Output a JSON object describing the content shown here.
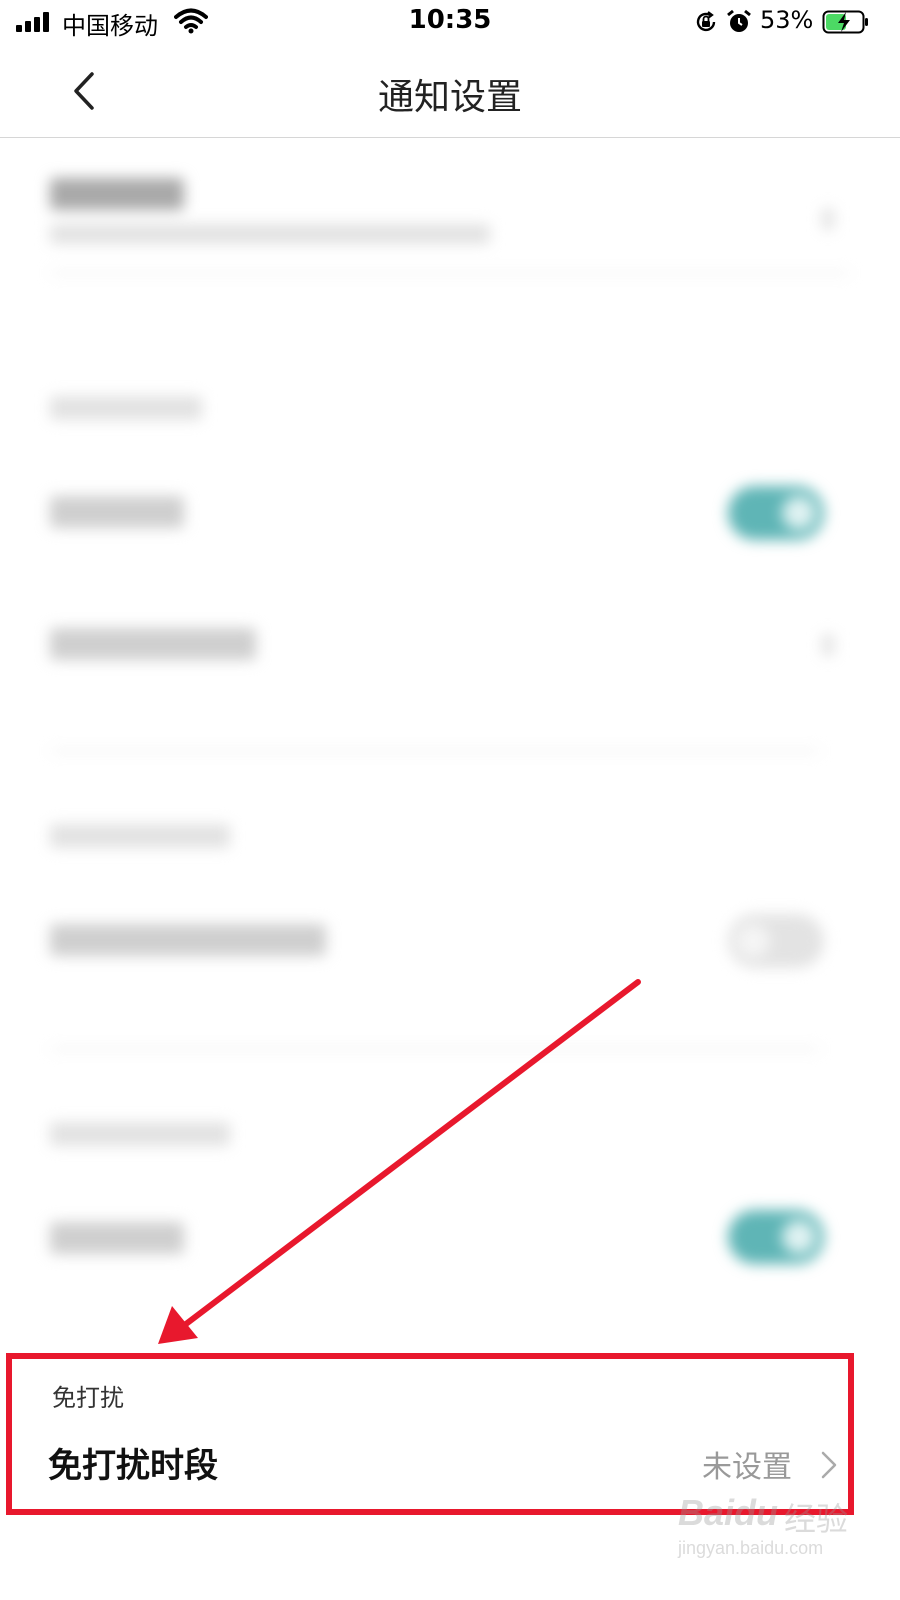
{
  "status_bar": {
    "carrier": "中国移动",
    "time": "10:35",
    "battery_percent": "53%",
    "icons": [
      "signal-icon",
      "wifi-icon",
      "rotation-lock-icon",
      "alarm-icon",
      "battery-charging-icon"
    ]
  },
  "nav": {
    "title": "通知设置",
    "back_icon": "chevron-left-icon"
  },
  "toggles": {
    "device_notification": true,
    "task_result_notification": false,
    "third_toggle": true
  },
  "dnd_section": {
    "header": "免打扰",
    "row_label": "免打扰时段",
    "row_value": "未设置",
    "chevron_icon": "chevron-right-icon"
  },
  "watermark": {
    "brand": "Baidu",
    "brand_cn": "经验",
    "url": "jingyan.baidu.com"
  },
  "colors": {
    "accent_toggle": "#5fb5b6",
    "annotation_red": "#e8182d"
  }
}
